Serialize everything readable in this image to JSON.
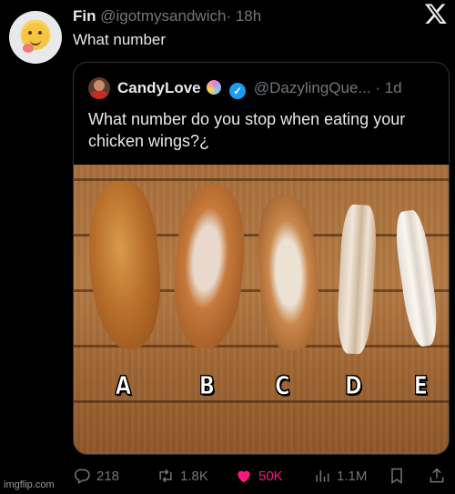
{
  "tweet": {
    "author_name": "Fin",
    "author_handle": "@igotmysandwich",
    "time": "· 18h",
    "text": "What number"
  },
  "quoted": {
    "author_name": "CandyLove",
    "author_handle": "@DazylingQue...",
    "time": "· 1d",
    "text": "What number do you stop when eating your chicken wings?¿",
    "image_labels": [
      "A",
      "B",
      "C",
      "D",
      "E"
    ]
  },
  "stats": {
    "replies": "218",
    "retweets": "1.8K",
    "likes": "50K",
    "views": "1.1M"
  },
  "watermark": "imgflip.com",
  "colors": {
    "background": "#000000",
    "muted": "#71767b",
    "like": "#f91880",
    "verified": "#1d9bf0",
    "border": "#2f3336"
  },
  "icons": [
    "x-logo-icon",
    "verified-icon",
    "lollipop-icon",
    "reply-icon",
    "retweet-icon",
    "heart-icon",
    "views-icon",
    "bookmark-icon",
    "share-icon"
  ]
}
